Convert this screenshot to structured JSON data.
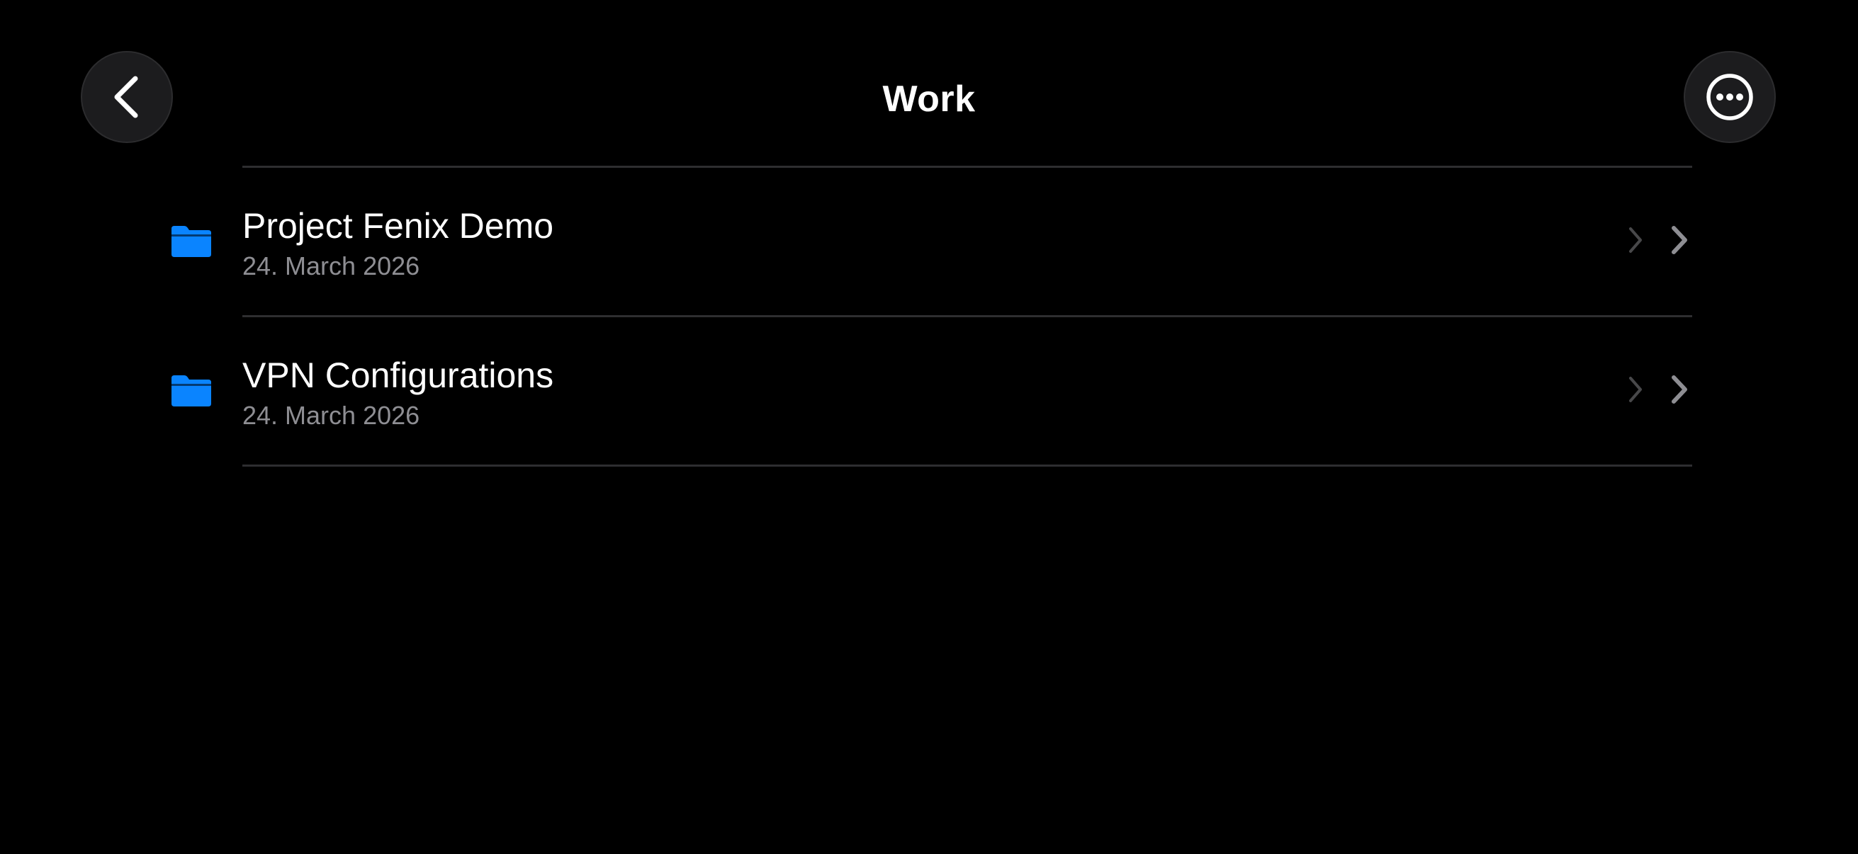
{
  "header": {
    "title": "Work",
    "back_icon": "chevron-left-icon",
    "more_icon": "ellipsis-circle-icon"
  },
  "folders": [
    {
      "name": "Project Fenix Demo",
      "date": "24. March 2026",
      "icon": "folder-icon"
    },
    {
      "name": "VPN Configurations",
      "date": "24. March 2026",
      "icon": "folder-icon"
    }
  ],
  "colors": {
    "background": "#000000",
    "folder_accent": "#0a84ff",
    "secondary_text": "#8e8e93",
    "separator": "#2e2e30",
    "button_fill": "#1c1c1e"
  }
}
